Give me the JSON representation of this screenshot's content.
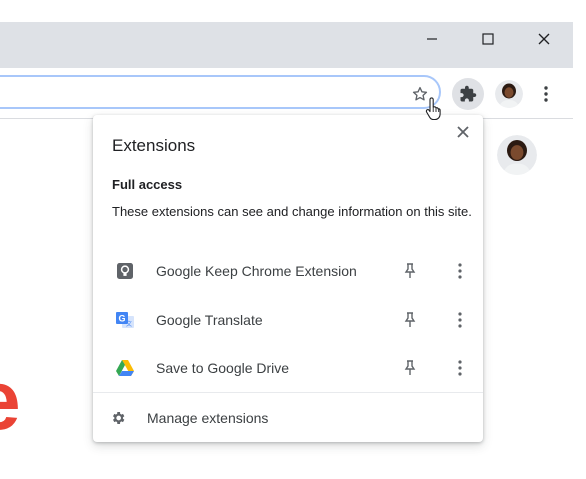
{
  "window": {
    "minimize_icon": "minimize-icon",
    "maximize_icon": "maximize-icon",
    "close_icon": "close-icon"
  },
  "toolbar": {
    "bookmark_icon": "star-icon",
    "extensions_icon": "puzzle-icon",
    "menu_icon": "three-dots-vertical-icon"
  },
  "extensions_popup": {
    "title": "Extensions",
    "close_icon": "close-icon",
    "section_heading": "Full access",
    "section_description": "These extensions can see and change information on this site.",
    "items": [
      {
        "name": "Google Keep Chrome Extension",
        "icon": "google-keep-icon"
      },
      {
        "name": "Google Translate",
        "icon": "google-translate-icon"
      },
      {
        "name": "Save to Google Drive",
        "icon": "google-drive-icon"
      }
    ],
    "manage_label": "Manage extensions"
  },
  "colors": {
    "titlebar": "#dee1e6",
    "omnibox_border": "#a8c7fa",
    "logo_red": "#ea4335"
  }
}
